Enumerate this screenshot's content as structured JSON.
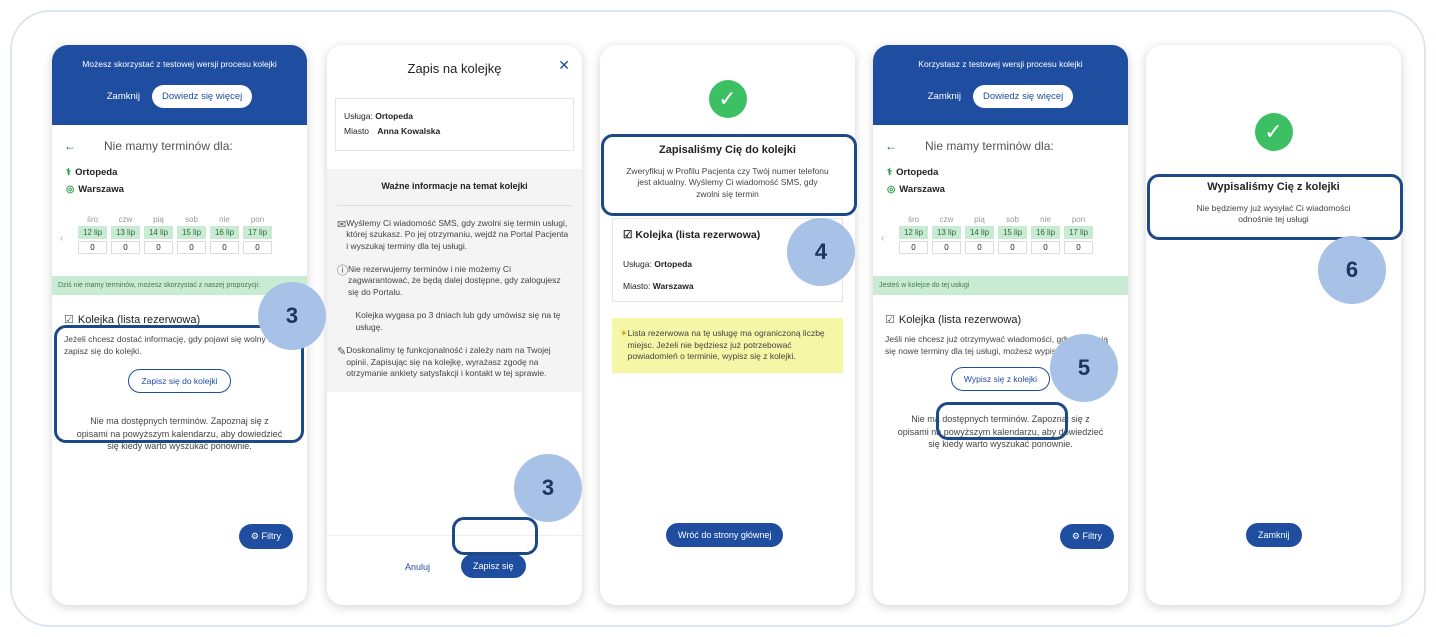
{
  "screen1": {
    "banner": "Możesz skorzystać z testowej wersji procesu kolejki",
    "close": "Zamknij",
    "learn_more": "Dowiedz się więcej",
    "no_dates": "Nie mamy terminów dla:",
    "service": "Ortopeda",
    "city": "Warszawa",
    "days": [
      "śro",
      "czw",
      "pią",
      "sob",
      "nie",
      "pon"
    ],
    "dates": [
      "12 lip",
      "13 lip",
      "14 lip",
      "15 lip",
      "16 lip",
      "17 lip"
    ],
    "counts": [
      "0",
      "0",
      "0",
      "0",
      "0",
      "0"
    ],
    "notice": "Dziś nie mamy terminów, możesz skorzystać z naszej propozycji:",
    "queue_title": "Kolejka (lista rezerwowa)",
    "queue_text": "Jeżeli chcesz dostać informację, gdy pojawi się wolny termin, zapisz się do kolejki.",
    "queue_button": "Zapisz się do kolejki",
    "footer": "Nie ma dostępnych terminów. Zapoznaj się z opisami na powyższym kalendarzu, aby dowiedzieć się kiedy warto wyszukać ponownie.",
    "filters": "Filtry"
  },
  "screen2": {
    "title": "Zapis na kolejkę",
    "service_label": "Usługa:",
    "service_value": "Ortopeda",
    "city_label": "Miasto",
    "patient": "Anna Kowalska",
    "info_title": "Ważne informacje na temat kolejki",
    "info1": "Wyślemy Ci wiadomość SMS, gdy zwolni się termin usługi, której szukasz. Po jej otrzymaniu, wejdź na Portal Pacjenta i wyszukaj terminy dla tej usługi.",
    "info2": "Nie rezerwujemy terminów i nie możemy Ci zagwarantować, że będą dalej dostępne, gdy zalogujesz się do Portalu.",
    "info3": "Kolejka wygasa po 3 dniach lub gdy umówisz się na tę usługę.",
    "info4": "Doskonalimy tę funkcjonalność i zależy nam na Twojej opinii. Zapisując się na kolejkę, wyrażasz zgodę na otrzymanie ankiety satysfakcji i kontakt w tej sprawie.",
    "cancel": "Anuluj",
    "submit": "Zapisz się"
  },
  "screen3": {
    "title": "Zapisaliśmy Cię do kolejki",
    "subtitle": "Zweryfikuj w Profilu Pacjenta czy Twój numer telefonu jest aktualny. Wyślemy Ci wiadomość SMS, gdy zwolni się termin",
    "card_title": "Kolejka (lista rezerwowa)",
    "service_label": "Usługa:",
    "service_value": "Ortopeda",
    "city_label": "Miasto:",
    "city_value": "Warszawa",
    "warning": "Lista rezerwowa na tę usługę ma ograniczoną liczbę miejsc. Jeżeli nie będziesz już potrzebować powiadomień o terminie, wypisz się z kolejki.",
    "home_button": "Wróć do strony głównej"
  },
  "screen4": {
    "banner": "Korzystasz z testowej wersji procesu kolejki",
    "close": "Zamknij",
    "learn_more": "Dowiedz się więcej",
    "no_dates": "Nie mamy terminów dla:",
    "service": "Ortopeda",
    "city": "Warszawa",
    "days": [
      "śro",
      "czw",
      "pią",
      "sob",
      "nie",
      "pon"
    ],
    "dates": [
      "12 lip",
      "13 lip",
      "14 lip",
      "15 lip",
      "16 lip",
      "17 lip"
    ],
    "counts": [
      "0",
      "0",
      "0",
      "0",
      "0",
      "0"
    ],
    "notice": "Jesteś w kolejce do tej usługi",
    "queue_title": "Kolejka (lista rezerwowa)",
    "queue_text": "Jeśli nie chcesz już otrzymywać wiadomości, gdy pojawiają się nowe terminy dla tej usługi, możesz wypisać się z kolejki.",
    "queue_button": "Wypisz się z kolejki",
    "footer": "Nie ma dostępnych terminów. Zapoznaj się z opisami na powyższym kalendarzu, aby dowiedzieć się kiedy warto wyszukać ponownie.",
    "filters": "Filtry"
  },
  "screen5": {
    "title": "Wypisaliśmy Cię z kolejki",
    "subtitle": "Nie będziemy już wysyłać Ci wiadomości odnośnie tej usługi",
    "close_button": "Zamknij"
  },
  "badges": [
    "3",
    "3",
    "4",
    "5",
    "6"
  ],
  "colors": {
    "brand": "#1f4ea1",
    "badge": "#a7c2e6",
    "success": "#3cc063",
    "highlight": "#1d4a86"
  }
}
